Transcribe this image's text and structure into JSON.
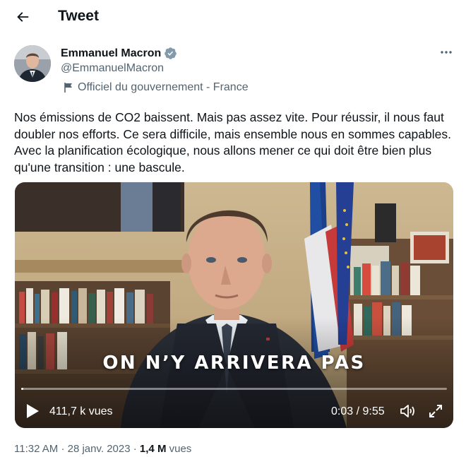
{
  "header": {
    "title": "Tweet",
    "back_icon": "arrow-left-icon"
  },
  "author": {
    "name": "Emmanuel Macron",
    "handle": "@EmmanuelMacron",
    "verified_color": "#829aab",
    "affiliation": "Officiel du gouvernement - France",
    "affiliation_icon": "flag-icon"
  },
  "tweet": {
    "text": "Nos émissions de CO2 baissent. Mais pas assez vite. Pour réussir, il nous faut doubler nos efforts. Ce sera difficile, mais ensemble nous en sommes capables. Avec la planification écologique, nous allons mener ce qui doit être bien plus qu'une transition : une bascule."
  },
  "video": {
    "caption": "ON N’Y ARRIVERA PAS",
    "views": "411,7 k vues",
    "time": "0:03 / 9:55",
    "progress_fraction": 0.005
  },
  "meta": {
    "time": "11:32 AM",
    "separator": "·",
    "date": "28 janv. 2023",
    "views_count": "1,4 M",
    "views_label": "vues"
  },
  "colors": {
    "text": "#0f1419",
    "secondary": "#536471",
    "accent": "#1d9bf0"
  }
}
